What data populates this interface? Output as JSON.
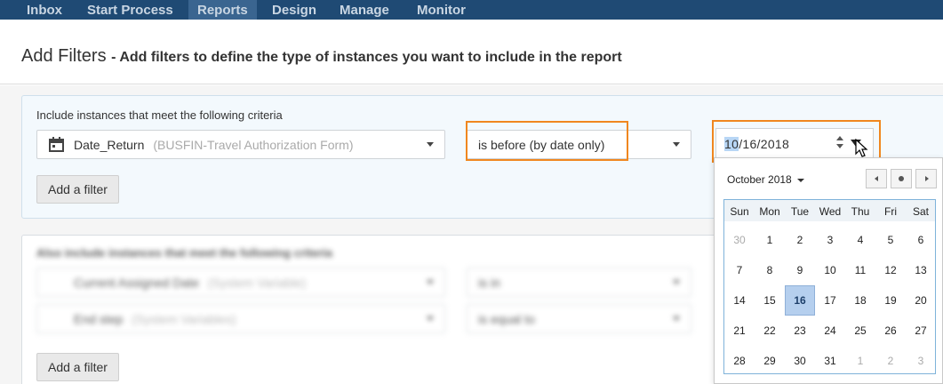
{
  "nav": {
    "items": [
      {
        "label": "Inbox"
      },
      {
        "label": "Start Process"
      },
      {
        "label": "Reports",
        "active": true
      },
      {
        "label": "Design"
      },
      {
        "label": "Manage"
      },
      {
        "label": "Monitor"
      }
    ]
  },
  "header": {
    "title": "Add Filters",
    "subtitle": "- Add filters to define the type of instances you want to include in the report"
  },
  "filter_group_1": {
    "label": "Include instances that meet the following criteria",
    "field": {
      "name": "Date_Return",
      "source": "(BUSFIN-Travel Authorization Form)",
      "icon": "calendar-icon"
    },
    "operator": "is before (by date only)",
    "date": {
      "month_selected": "10",
      "rest": "/16/2018"
    },
    "add_filter": "Add a filter"
  },
  "filter_group_2": {
    "label": "Also include instances that meet the following criteria",
    "rows": [
      {
        "field": "Current Assigned Date",
        "source": "(System Variable)",
        "operator": "is in"
      },
      {
        "field": "End step",
        "source": "(System Variables)",
        "operator": "is equal to"
      }
    ],
    "add_filter": "Add a filter"
  },
  "calendar": {
    "month_label": "October 2018",
    "weekdays": [
      "Sun",
      "Mon",
      "Tue",
      "Wed",
      "Thu",
      "Fri",
      "Sat"
    ],
    "weeks": [
      [
        {
          "d": "30",
          "o": true
        },
        {
          "d": "1"
        },
        {
          "d": "2"
        },
        {
          "d": "3"
        },
        {
          "d": "4"
        },
        {
          "d": "5"
        },
        {
          "d": "6"
        }
      ],
      [
        {
          "d": "7"
        },
        {
          "d": "8"
        },
        {
          "d": "9"
        },
        {
          "d": "10"
        },
        {
          "d": "11"
        },
        {
          "d": "12"
        },
        {
          "d": "13"
        }
      ],
      [
        {
          "d": "14"
        },
        {
          "d": "15"
        },
        {
          "d": "16",
          "s": true
        },
        {
          "d": "17"
        },
        {
          "d": "18"
        },
        {
          "d": "19"
        },
        {
          "d": "20"
        }
      ],
      [
        {
          "d": "21"
        },
        {
          "d": "22"
        },
        {
          "d": "23"
        },
        {
          "d": "24"
        },
        {
          "d": "25"
        },
        {
          "d": "26"
        },
        {
          "d": "27"
        }
      ],
      [
        {
          "d": "28"
        },
        {
          "d": "29"
        },
        {
          "d": "30"
        },
        {
          "d": "31"
        },
        {
          "d": "1",
          "o": true
        },
        {
          "d": "2",
          "o": true
        },
        {
          "d": "3",
          "o": true
        }
      ]
    ]
  },
  "colors": {
    "nav_bg": "#1f4a74",
    "highlight": "#f0871f",
    "selected_day": "#b5cfee",
    "panel_bg": "#f3f9fd"
  }
}
